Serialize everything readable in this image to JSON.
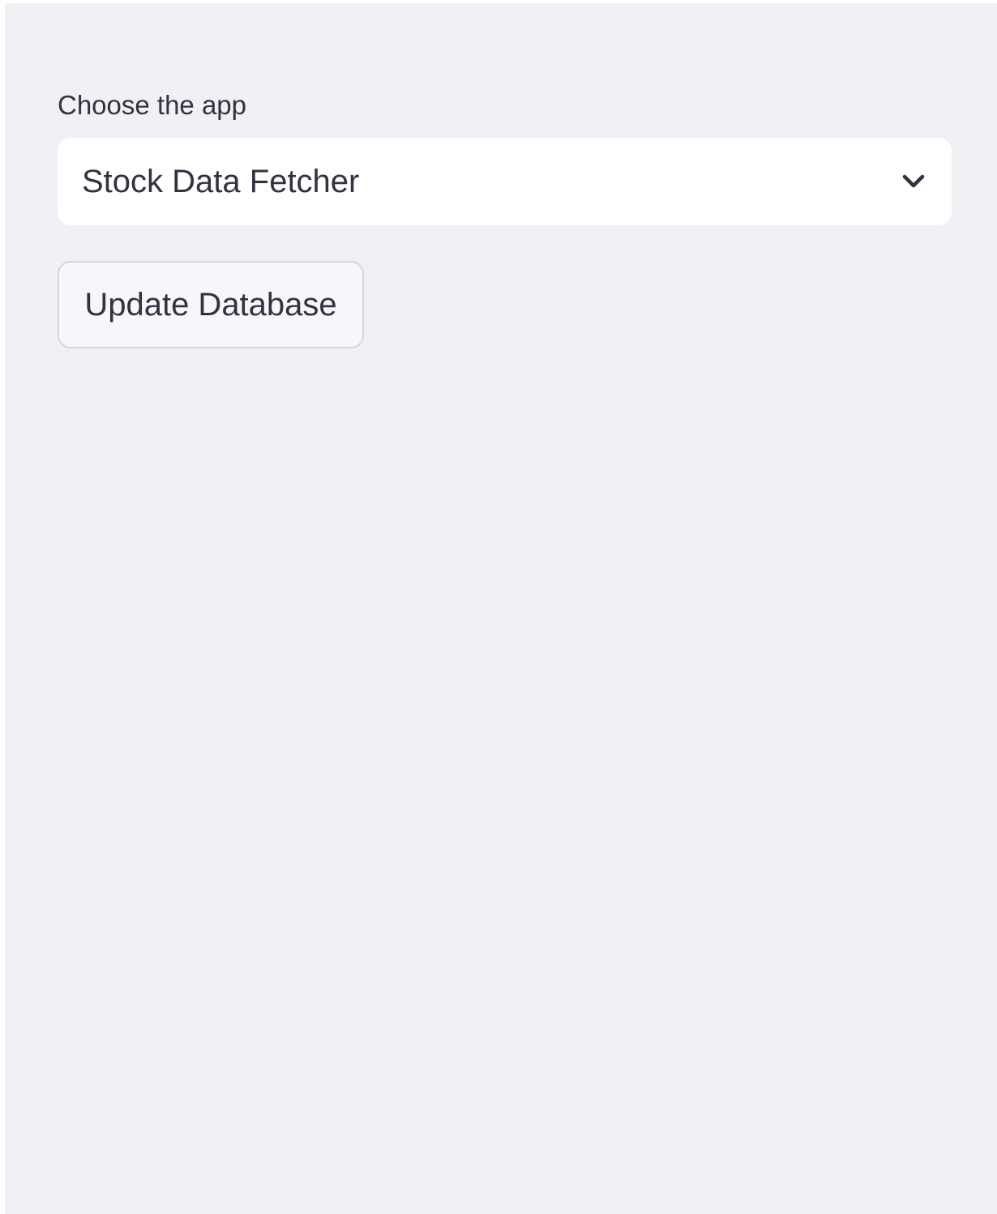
{
  "sidebar": {
    "select": {
      "label": "Choose the app",
      "selected_value": "Stock Data Fetcher",
      "icon": "chevron-down-icon"
    },
    "update_button": {
      "label": "Update Database"
    }
  },
  "colors": {
    "sidebar_background": "#f0f0f5",
    "text": "#31333f",
    "input_background": "#ffffff",
    "button_border": "#d6d6e0"
  }
}
